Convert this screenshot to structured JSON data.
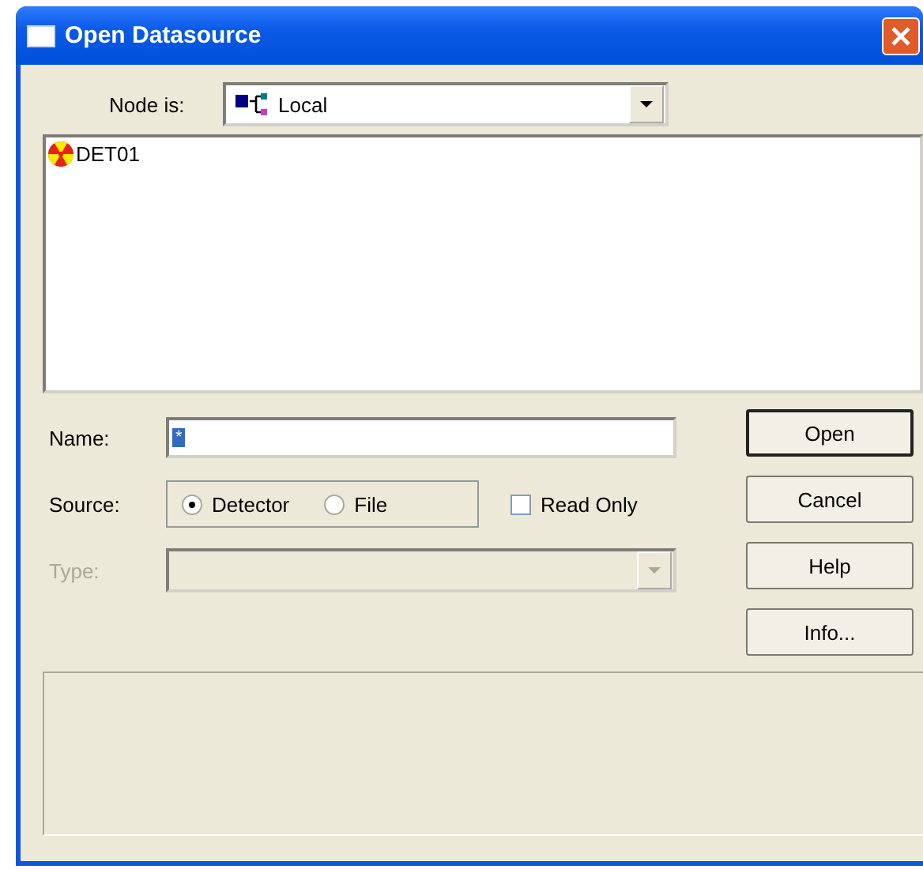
{
  "window": {
    "title": "Open Datasource"
  },
  "node": {
    "label": "Node is:",
    "value": "Local"
  },
  "datasources": [
    {
      "name": "DET01"
    }
  ],
  "name": {
    "label": "Name:",
    "value": "*"
  },
  "source": {
    "label": "Source:",
    "options": [
      {
        "label": "Detector",
        "selected": true
      },
      {
        "label": "File",
        "selected": false
      }
    ]
  },
  "read_only": {
    "label": "Read Only",
    "checked": false
  },
  "type": {
    "label": "Type:",
    "disabled": true
  },
  "buttons": [
    {
      "label": "Open",
      "default": true
    },
    {
      "label": "Cancel",
      "default": false
    },
    {
      "label": "Help",
      "default": false
    },
    {
      "label": "Info...",
      "default": false
    }
  ]
}
